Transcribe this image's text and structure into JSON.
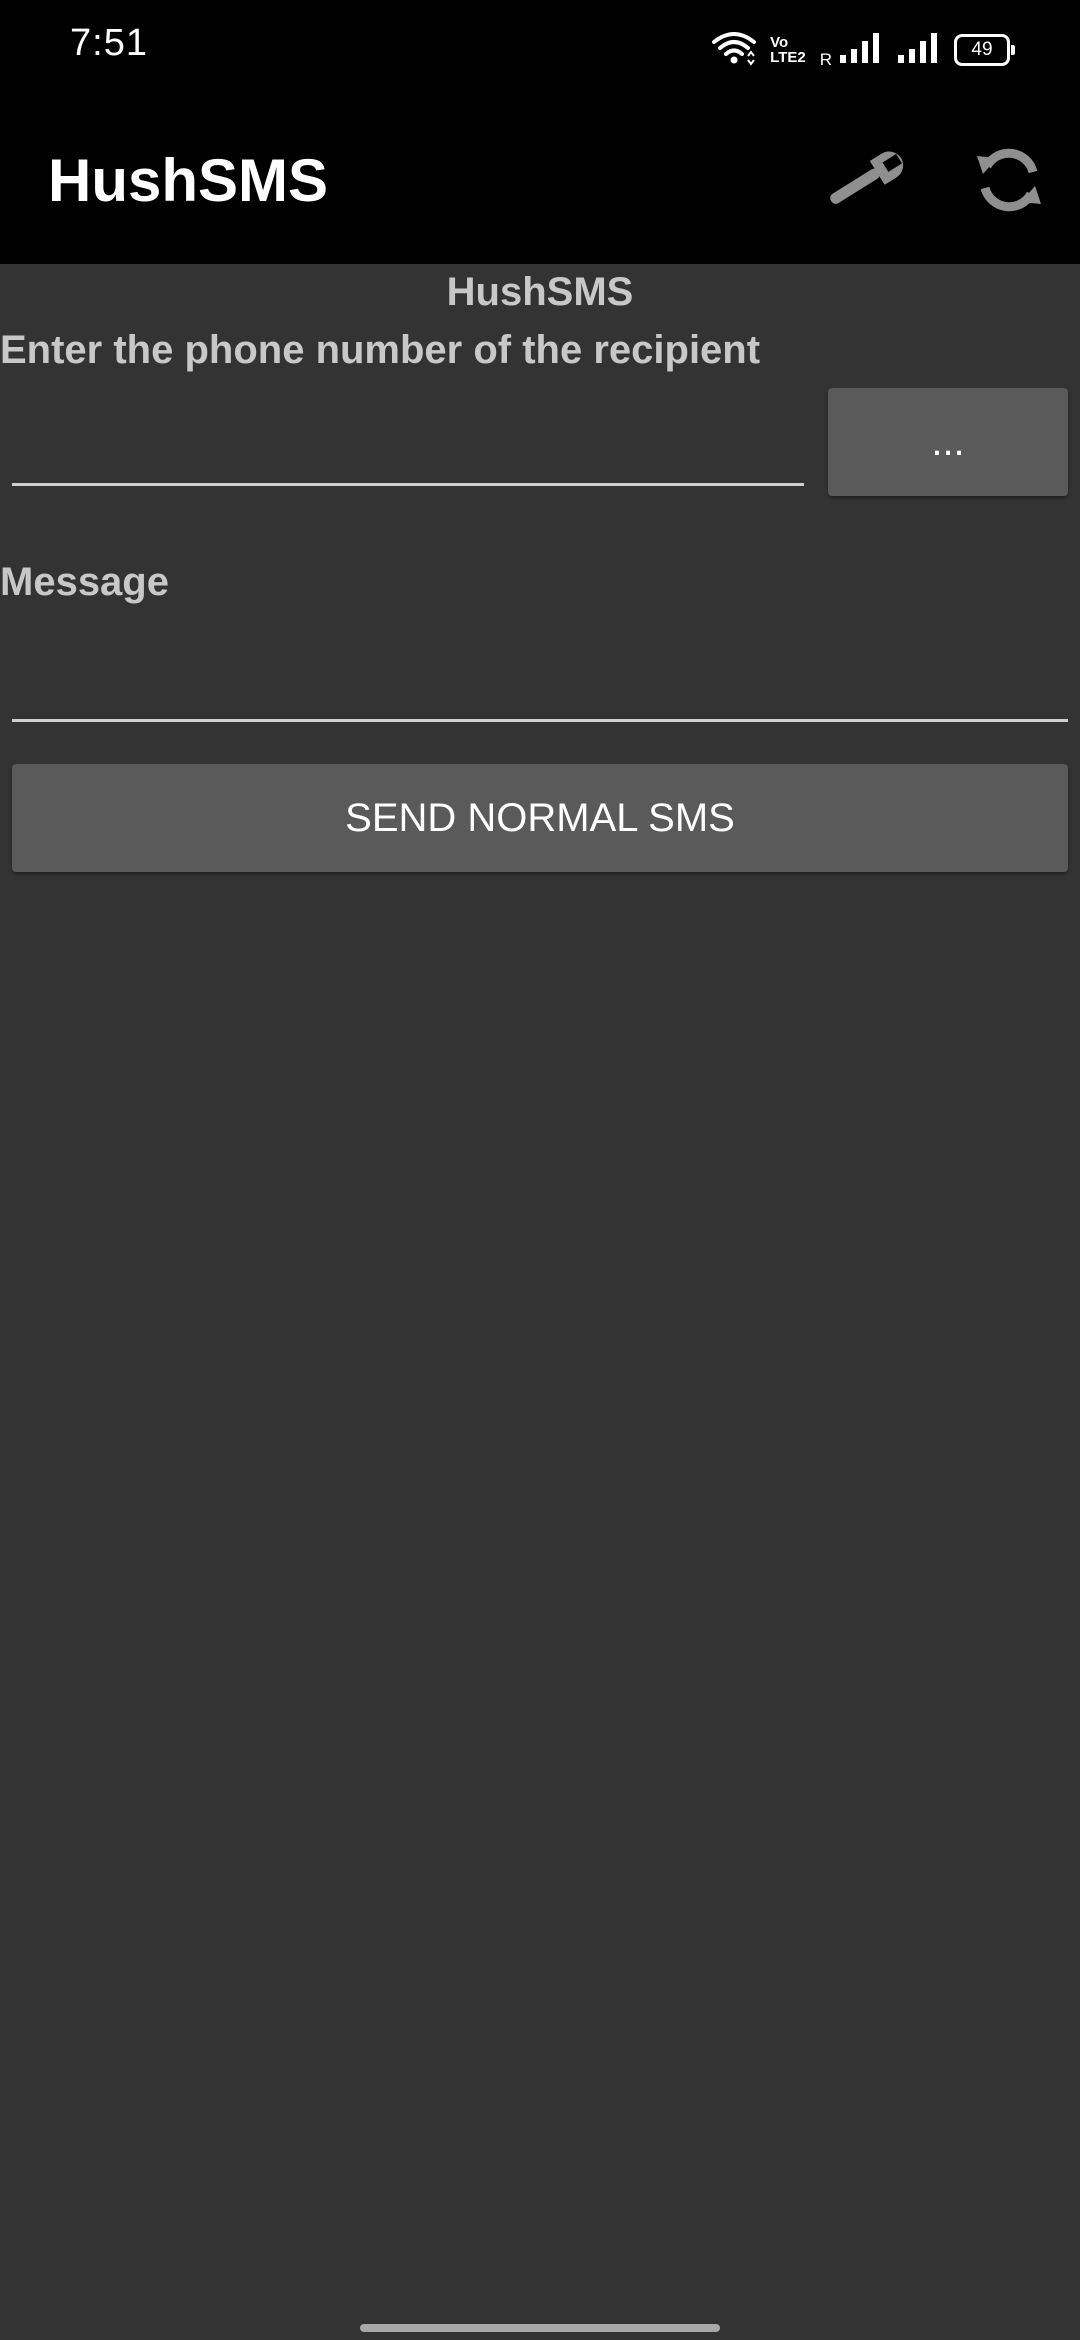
{
  "status_bar": {
    "time": "7:51",
    "volte_top": "Vo",
    "volte_bottom": "LTE2",
    "roaming": "R",
    "battery": "49",
    "icons": [
      "wifi-icon",
      "volte-icon",
      "signal-icon",
      "signal-icon",
      "battery-icon"
    ]
  },
  "app_bar": {
    "title": "HushSMS",
    "actions": [
      {
        "name": "settings",
        "icon": "wrench-icon"
      },
      {
        "name": "refresh",
        "icon": "refresh-icon"
      }
    ]
  },
  "main": {
    "header": "HushSMS",
    "phone_label": "Enter the phone number of the recipient",
    "phone_value": "",
    "contacts_button_label": "...",
    "message_label": "Message",
    "message_value": "",
    "send_button_label": "SEND NORMAL SMS"
  },
  "colors": {
    "background": "#333333",
    "bar": "#000000",
    "label": "#c8c8c8",
    "button": "#5a5a5a",
    "text": "#ffffff"
  }
}
